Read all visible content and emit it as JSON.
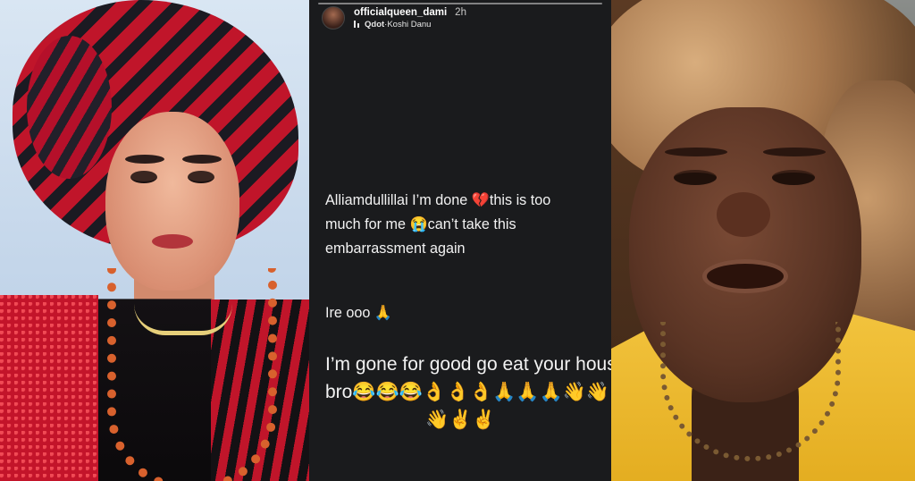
{
  "story": {
    "username": "officialqueen_dami",
    "time": "2h",
    "music": {
      "artist": "Qdot",
      "separator": " · ",
      "track": "Koshi Danu"
    },
    "caption_lines": [
      "Alliamdullillai I’m done 💔this is too",
      "much for me 😭can’t take this",
      "embarrassment again"
    ],
    "line_ire": "Ire ooo 🙏",
    "big_lines": [
      "I’m gone for good go eat your house",
      "bro😂😂😂👌👌👌🙏🙏🙏👋👋",
      "👋✌️✌️"
    ]
  },
  "icons": {
    "avatar": "profile-avatar",
    "music": "music-note-icon"
  },
  "colors": {
    "story_bg": "#1a1b1d",
    "text": "#f2f2f2",
    "jacket": "#f2c33d",
    "gele_red": "#c0152a"
  }
}
